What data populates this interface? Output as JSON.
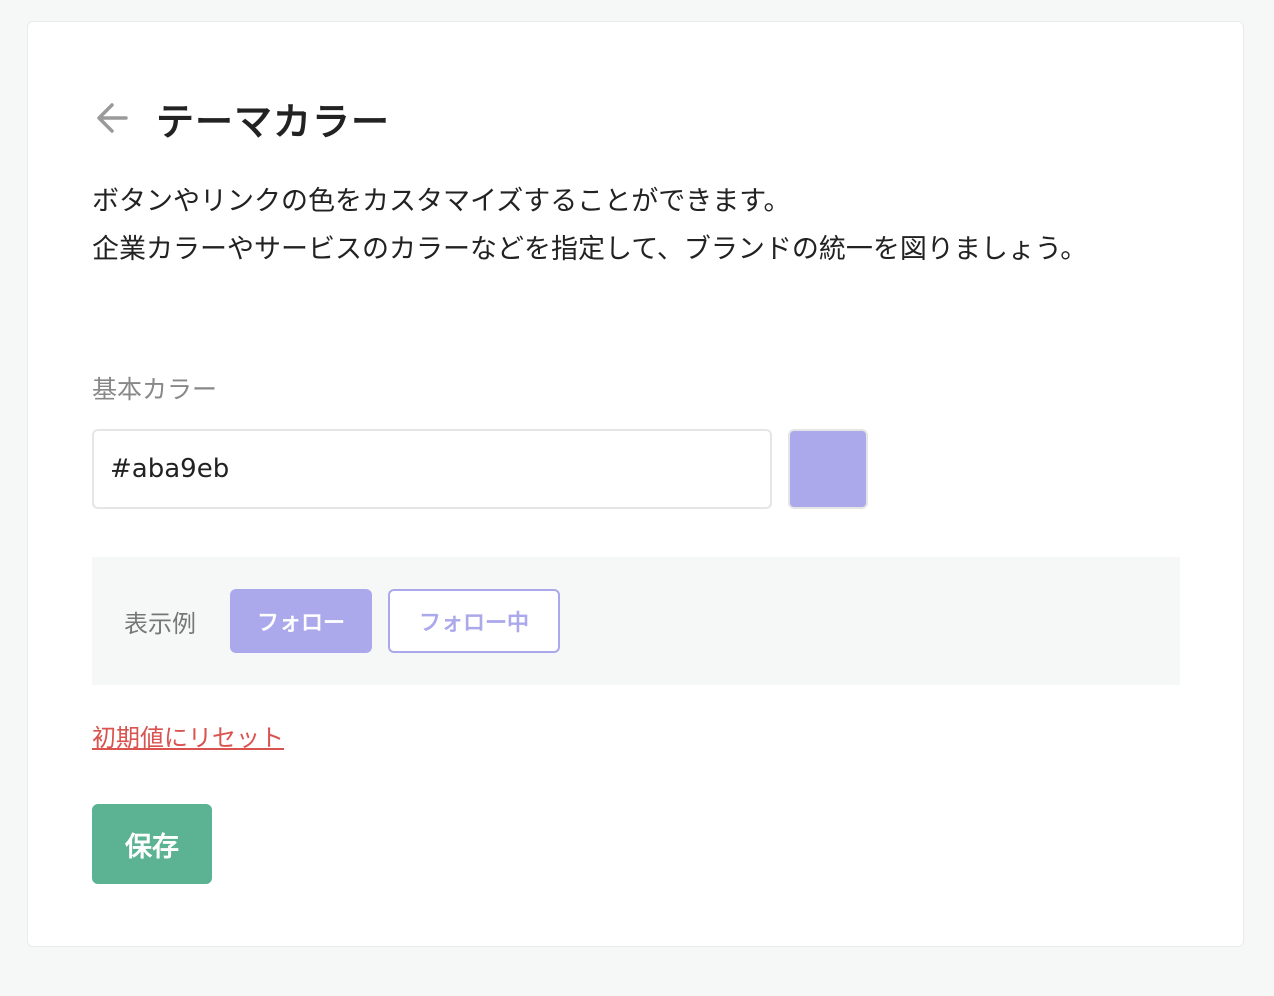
{
  "header": {
    "back_icon": "arrow-left-icon",
    "title": "テーマカラー"
  },
  "description": {
    "line1": "ボタンやリンクの色をカスタマイズすることができます。",
    "line2": "企業カラーやサービスのカラーなどを指定して、ブランドの統一を図りましょう。"
  },
  "base_color": {
    "label": "基本カラー",
    "value": "#aba9eb"
  },
  "preview": {
    "label": "表示例",
    "follow_label": "フォロー",
    "following_label": "フォロー中"
  },
  "reset_link": "初期値にリセット",
  "save_label": "保存",
  "colors": {
    "theme": "#aba9eb",
    "save_button": "#5bb394",
    "reset_link": "#d9534f",
    "arrow": "#9a9a9a"
  }
}
